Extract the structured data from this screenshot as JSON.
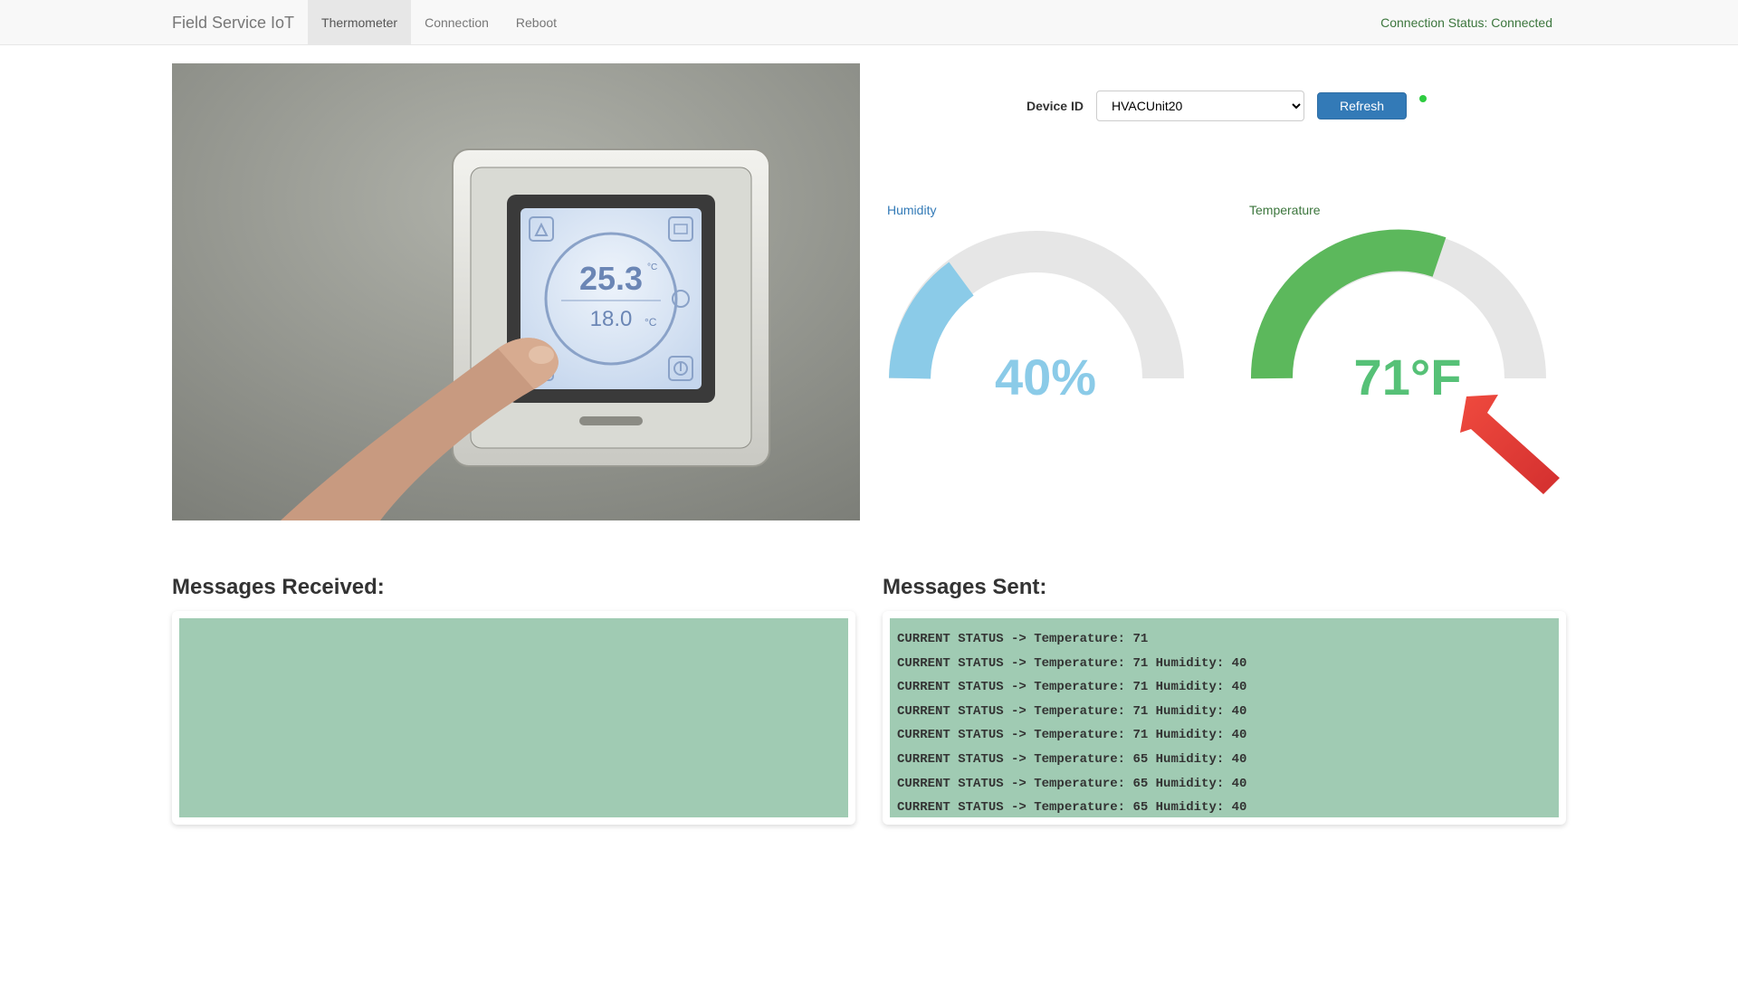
{
  "nav": {
    "brand": "Field Service IoT",
    "tabs": [
      {
        "label": "Thermometer",
        "active": true
      },
      {
        "label": "Connection",
        "active": false
      },
      {
        "label": "Reboot",
        "active": false
      }
    ],
    "conn_status_label": "Connection Status:",
    "conn_status_value": "Connected"
  },
  "device": {
    "label": "Device ID",
    "selected": "HVACUnit20",
    "refresh_label": "Refresh"
  },
  "humidity": {
    "title": "Humidity",
    "value": 40,
    "display": "40%",
    "color": "#8bcbe8"
  },
  "temperature": {
    "title": "Temperature",
    "value": 71,
    "display": "71°F",
    "color": "#5cb85c"
  },
  "messages_received": {
    "heading": "Messages Received:",
    "lines": []
  },
  "messages_sent": {
    "heading": "Messages Sent:",
    "lines": [
      "CURRENT STATUS -> Temperature: 71",
      "CURRENT STATUS -> Temperature: 71 Humidity: 40",
      "CURRENT STATUS -> Temperature: 71 Humidity: 40",
      "CURRENT STATUS -> Temperature: 71 Humidity: 40",
      "CURRENT STATUS -> Temperature: 71 Humidity: 40",
      "CURRENT STATUS -> Temperature: 65 Humidity: 40",
      "CURRENT STATUS -> Temperature: 65 Humidity: 40",
      "CURRENT STATUS -> Temperature: 65 Humidity: 40"
    ]
  },
  "chart_data": [
    {
      "type": "gauge",
      "title": "Humidity",
      "value": 40,
      "min": 0,
      "max": 100,
      "unit": "%",
      "color": "#8bcbe8"
    },
    {
      "type": "gauge",
      "title": "Temperature",
      "value": 71,
      "min": 0,
      "max": 120,
      "unit": "°F",
      "color": "#5cb85c"
    }
  ],
  "thermostat_photo": {
    "set_temp": "25.3",
    "set_temp_unit": "°C",
    "room_temp": "18.0",
    "room_temp_unit": "°C"
  }
}
